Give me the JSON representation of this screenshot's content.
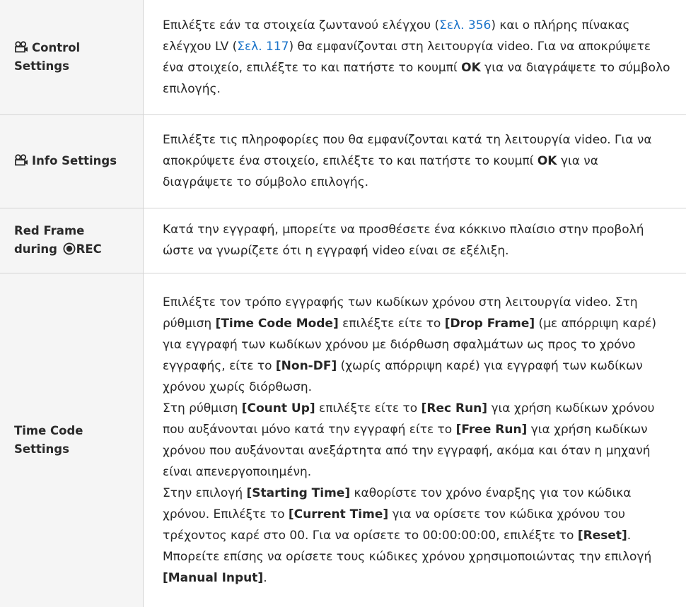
{
  "rows": [
    {
      "name": "Control Settings",
      "name_icon": "movie-icon",
      "description": {
        "p1": "Επιλέξτε εάν τα στοιχεία ζωντανού ελέγχου (",
        "link1": "Σελ. 356",
        "p2": ") και ο πλήρης πίνακας ελέγχου LV (",
        "link2": "Σελ. 117",
        "p3": ") θα εμφανίζονται στη λειτουργία video. Για να αποκρύψετε ένα στοιχείο, επιλέξτε το και πατήστε το κουμπί ",
        "ok": "OK",
        "p4": " για να διαγράψετε το σύμβολο επιλογής."
      }
    },
    {
      "name": "Info Settings",
      "name_icon": "movie-icon",
      "description": {
        "p1": "Επιλέξτε τις πληροφορίες που θα εμφανίζονται κατά τη λειτουργία video. Για να αποκρύψετε ένα στοιχείο, επιλέξτε το και πατήστε το κουμπί ",
        "ok": "OK",
        "p2": " για να διαγράψετε το σύμβολο επιλογής."
      }
    },
    {
      "name_line1": "Red Frame",
      "name_line2_prefix": "during ",
      "name_line2_suffix": "REC",
      "name_icon": "record-icon",
      "description": "Κατά την εγγραφή, μπορείτε να προσθέσετε ένα κόκκινο πλαίσιο στην προβολή ώστε να γνωρίζετε ότι η εγγραφή video είναι σε εξέλιξη."
    },
    {
      "name": "Time Code Settings",
      "description": {
        "para1": {
          "t1": "Επιλέξτε τον τρόπο εγγραφής των κωδίκων χρόνου στη λειτουργία video. Στη ρύθμιση ",
          "b1": "[Time Code Mode]",
          "t2": " επιλέξτε είτε το ",
          "b2": "[Drop Frame]",
          "t3": " (με απόρριψη καρέ) για εγγραφή των κωδίκων χρόνου με διόρθωση σφαλμάτων ως προς το χρόνο εγγραφής, είτε το ",
          "b3": "[Non-DF]",
          "t4": " (χωρίς απόρριψη καρέ) για εγγραφή των κωδίκων χρόνου χωρίς διόρθωση."
        },
        "para2": {
          "t1": "Στη ρύθμιση ",
          "b1": "[Count Up]",
          "t2": " επιλέξτε είτε το ",
          "b2": "[Rec Run]",
          "t3": " για χρήση κωδίκων χρόνου που αυξάνονται μόνο κατά την εγγραφή είτε το ",
          "b3": "[Free Run]",
          "t4": " για χρήση κωδίκων χρόνου που αυξάνονται ανεξάρτητα από την εγγραφή, ακόμα και όταν η μηχανή είναι απενεργοποιημένη."
        },
        "para3": {
          "t1": "Στην επιλογή ",
          "b1": "[Starting Time]",
          "t2": " καθορίστε τον χρόνο έναρξης για τον κώδικα χρόνου. Επιλέξτε το ",
          "b2": "[Current Time]",
          "t3": " για να ορίσετε τον κώδικα χρόνου του τρέχοντος καρέ στο 00. Για να ορίσετε το 00:00:00:00, επιλέξτε το ",
          "b3": "[Reset]",
          "t4": ". Μπορείτε επίσης να ορίσετε τους κώδικες χρόνου χρησιμοποιώντας την επιλογή ",
          "b4": "[Manual Input]",
          "t5": "."
        }
      }
    }
  ],
  "colors": {
    "link": "#1a73c9",
    "name_cell_bg": "#f5f5f5",
    "border": "#d4d4d4"
  }
}
